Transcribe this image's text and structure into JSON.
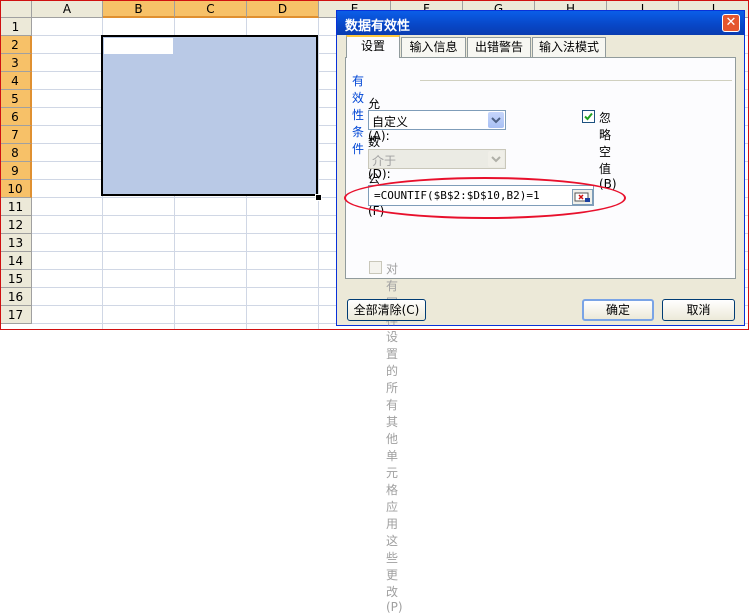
{
  "sheet": {
    "columns": [
      {
        "id": "a",
        "label": "A",
        "selected": false
      },
      {
        "id": "b",
        "label": "B",
        "selected": true
      },
      {
        "id": "c",
        "label": "C",
        "selected": true
      },
      {
        "id": "d",
        "label": "D",
        "selected": true
      },
      {
        "id": "e",
        "label": "E",
        "selected": false
      },
      {
        "id": "f",
        "label": "F",
        "selected": false
      },
      {
        "id": "g",
        "label": "G",
        "selected": false
      },
      {
        "id": "h",
        "label": "H",
        "selected": false
      },
      {
        "id": "i",
        "label": "I",
        "selected": false
      },
      {
        "id": "j",
        "label": "J",
        "selected": false
      }
    ],
    "rows": [
      "1",
      "2",
      "3",
      "4",
      "5",
      "6",
      "7",
      "8",
      "9",
      "10",
      "11",
      "12",
      "13",
      "14",
      "15",
      "16",
      "17"
    ],
    "selected_rows": [
      "2",
      "3",
      "4",
      "5",
      "6",
      "7",
      "8",
      "9",
      "10"
    ]
  },
  "dialog": {
    "title": "数据有效性",
    "close_icon": "close-icon",
    "tabs": [
      "设置",
      "输入信息",
      "出错警告",
      "输入法模式"
    ],
    "active_tab": "设置",
    "group_title": "有效性条件",
    "allow_label": "允许(A):",
    "allow_value": "自定义",
    "ignore_blank_label": "忽略空值(B)",
    "ignore_blank_checked": true,
    "data_label": "数据(D):",
    "data_value": "介于",
    "formula_label": "公式(F)",
    "formula_value": "=COUNTIF($B$2:$D$10,B2)=1",
    "apply_all_label": "对有同样设置的所有其他单元格应用这些更改(P)",
    "apply_all_checked": false,
    "clear_all_label": "全部清除(C)",
    "ok_label": "确定",
    "cancel_label": "取消"
  },
  "colors": {
    "selection": "#b9c9e6",
    "header_selected": "#f7c168",
    "title_bar": "#0a5ee8",
    "annotation": "#e8102c"
  }
}
